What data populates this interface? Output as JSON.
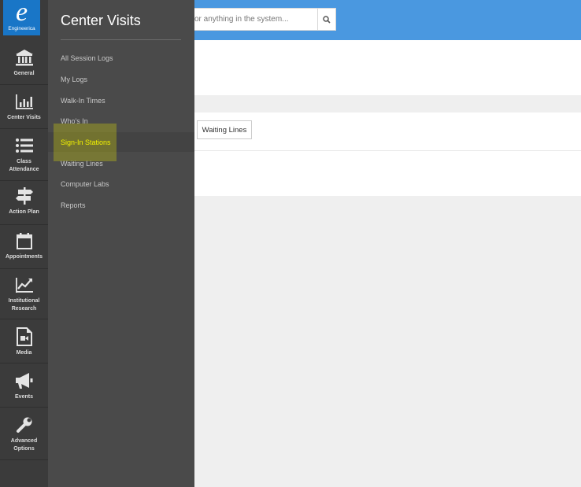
{
  "header": {
    "search_placeholder": "or anything in the system...",
    "search_icon": "search-icon"
  },
  "content": {
    "waiting_lines_button": "Waiting Lines"
  },
  "rail": {
    "logo_text": "Engineerica",
    "items": [
      {
        "label": "General",
        "icon": "institution-icon"
      },
      {
        "label": "Center Visits",
        "icon": "bar-chart-icon"
      },
      {
        "label": "Class Attendance",
        "icon": "list-icon"
      },
      {
        "label": "Action Plan",
        "icon": "signpost-icon"
      },
      {
        "label": "Appointments",
        "icon": "calendar-icon"
      },
      {
        "label": "Institutional Research",
        "icon": "line-chart-icon"
      },
      {
        "label": "Media",
        "icon": "media-file-icon"
      },
      {
        "label": "Events",
        "icon": "megaphone-icon"
      },
      {
        "label": "Advanced Options",
        "icon": "wrench-icon"
      }
    ]
  },
  "flyout": {
    "title": "Center Visits",
    "items": [
      {
        "label": "All Session Logs"
      },
      {
        "label": "My Logs"
      },
      {
        "label": "Walk-In Times"
      },
      {
        "label": "Who's In"
      },
      {
        "label": "Sign-In Stations",
        "active": true
      },
      {
        "label": "Waiting Lines"
      },
      {
        "label": "Computer Labs"
      },
      {
        "label": "Reports"
      }
    ]
  },
  "colors": {
    "header_blue": "#4a98e0",
    "rail_bg": "#3b3b3b",
    "flyout_bg": "#4a4a4a",
    "active_text": "#f4f400"
  }
}
